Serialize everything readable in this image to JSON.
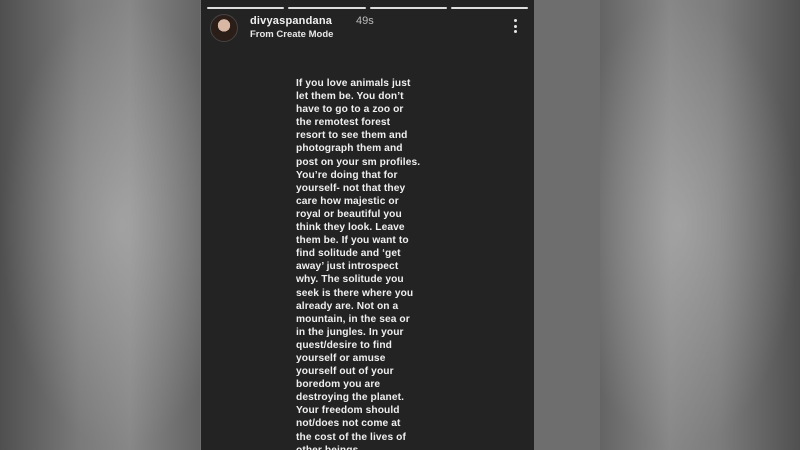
{
  "story": {
    "username": "divyaspandana",
    "time": "49s",
    "subtitle": "From Create Mode",
    "text": "If you love animals just\nlet them be. You don’t\nhave to go to a zoo or\nthe remotest forest\nresort to see them and\nphotograph them and\npost on your sm profiles.\nYou’re doing that for\nyourself- not that they\ncare how majestic or\nroyal or beautiful you\nthink they look. Leave\nthem be. If you want to\nfind solitude and ‘get\naway’ just introspect\nwhy. The solitude you\nseek is there where you\nalready are. Not on a\nmountain, in the sea or\nin the jungles. In your\nquest/desire to find\nyourself or amuse\nyourself out of your\nboredom  you are\ndestroying the planet.\nYour freedom should\nnot/does not come at\nthe cost of the lives of\nother beings."
  },
  "icons": {
    "avatar": "profile-avatar",
    "menu": "more-options-icon"
  },
  "colors": {
    "story_background": "#232323",
    "text": "#efefef",
    "progress": "#ffffff"
  }
}
